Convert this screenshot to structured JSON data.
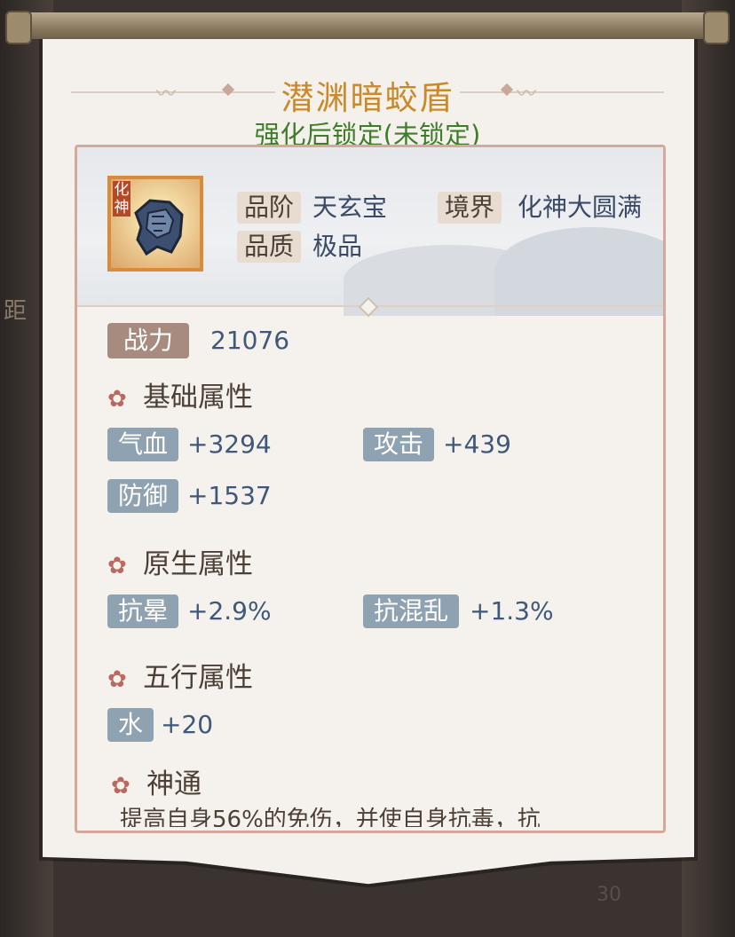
{
  "item": {
    "name": "潜渊暗蛟盾",
    "lock_status": "强化后锁定(未锁定)",
    "icon_tag": "化神",
    "icon_name": "shield-icon"
  },
  "info": {
    "grade_label": "品阶",
    "grade_value": "天玄宝",
    "realm_label": "境界",
    "realm_value": "化神大圆满",
    "quality_label": "品质",
    "quality_value": "极品"
  },
  "power": {
    "label": "战力",
    "value": "21076"
  },
  "sections": {
    "base": {
      "title": "基础属性",
      "stats": [
        {
          "label": "气血",
          "value": "+3294"
        },
        {
          "label": "攻击",
          "value": "+439"
        },
        {
          "label": "防御",
          "value": "+1537"
        }
      ]
    },
    "native": {
      "title": "原生属性",
      "stats": [
        {
          "label": "抗晕",
          "value": "+2.9%"
        },
        {
          "label": "抗混乱",
          "value": "+1.3%"
        }
      ]
    },
    "element": {
      "title": "五行属性",
      "stats": [
        {
          "label": "水",
          "value": "+20"
        }
      ]
    },
    "skill": {
      "title": "神通",
      "description": "提高自身56%的免伤，并使自身抗毒，抗"
    }
  },
  "background": {
    "side_text": "距",
    "bottom_number": "30"
  },
  "colors": {
    "title": "#c98a2c",
    "lock_status": "#3f7d2a",
    "stat_chip": "#8ea2b2",
    "power_chip": "#a78b7e",
    "value": "#3f5778"
  }
}
